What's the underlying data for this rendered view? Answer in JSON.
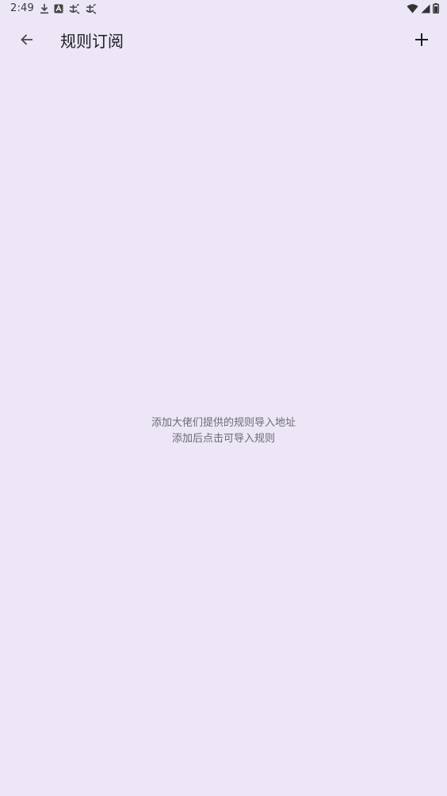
{
  "status_bar": {
    "time": "2:49",
    "left_icons": [
      "download-icon",
      "a-box-icon",
      "bug-icon",
      "bug-icon"
    ],
    "right_icons": [
      "wifi-icon",
      "signal-icon",
      "battery-icon"
    ]
  },
  "app_bar": {
    "title": "规则订阅",
    "back_icon": "arrow-back-icon",
    "add_icon": "plus-icon"
  },
  "empty_state": {
    "line1": "添加大佬们提供的规则导入地址",
    "line2": "添加后点击可导入规则"
  },
  "colors": {
    "background": "#ECE6F7",
    "title_text": "#1D1B20",
    "hint_text": "#6E6A72"
  }
}
